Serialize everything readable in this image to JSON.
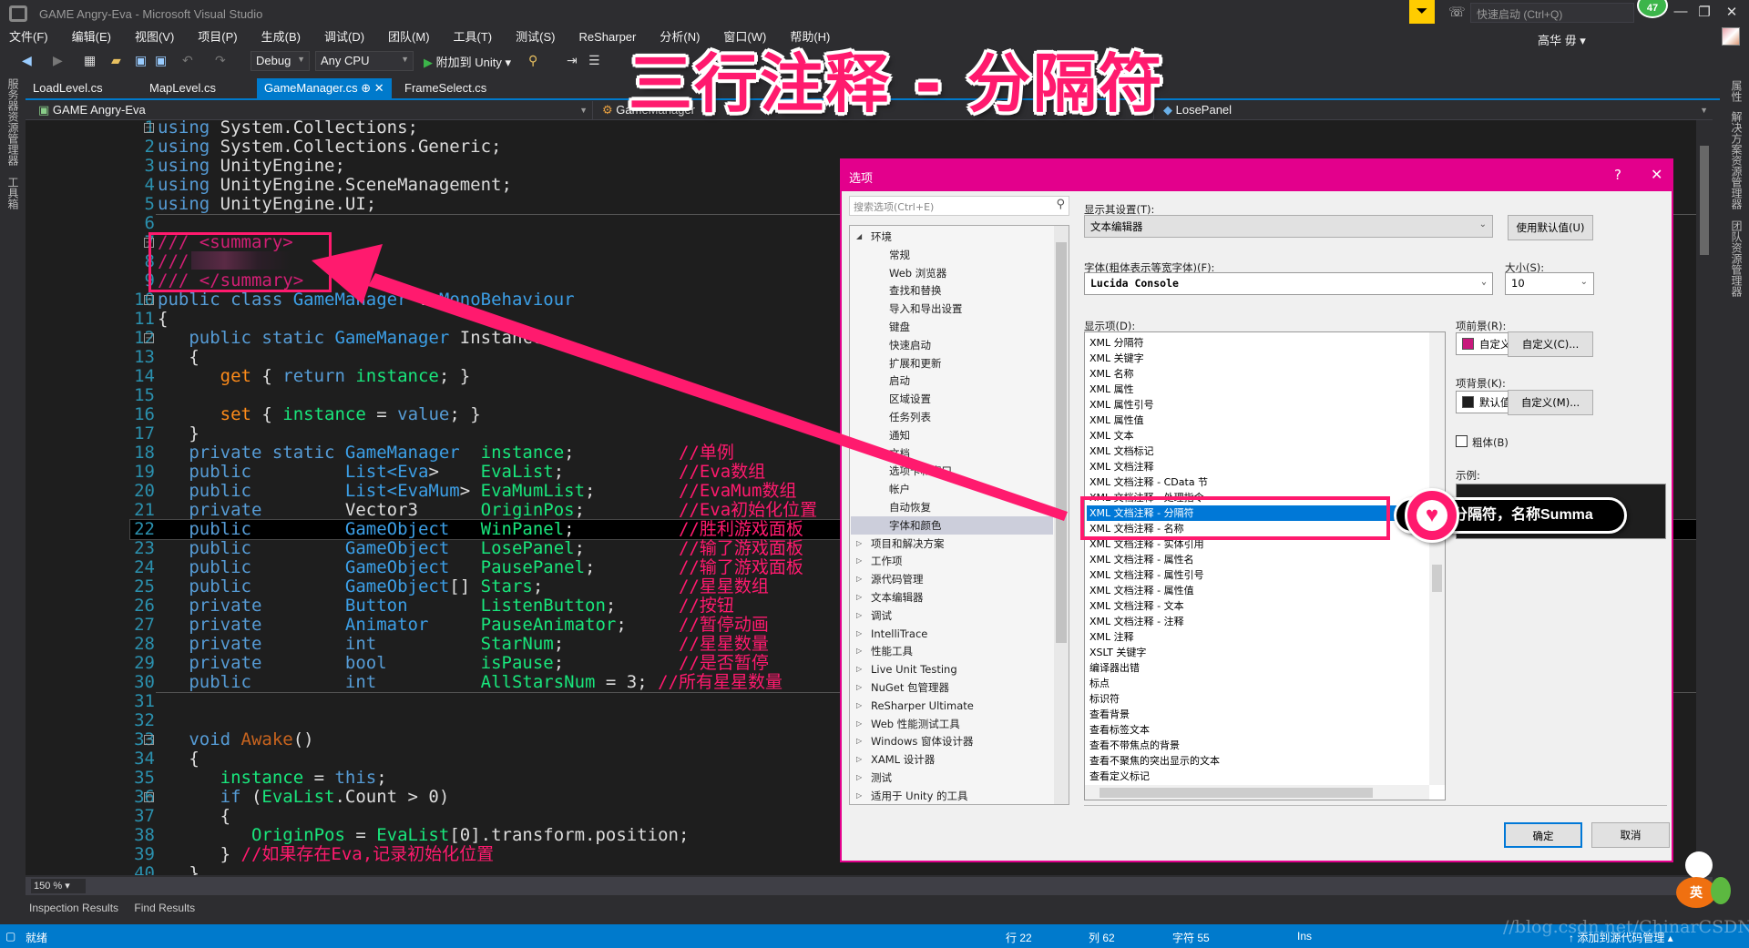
{
  "window": {
    "title": "GAME  Angry-Eva - Microsoft Visual Studio",
    "quick_launch_placeholder": "快速启动 (Ctrl+Q)",
    "notification_count": "47",
    "user_name": "高华 毋 ▾",
    "minimize": "—",
    "restore": "❐",
    "close": "✕"
  },
  "menu": [
    "文件(F)",
    "编辑(E)",
    "视图(V)",
    "项目(P)",
    "生成(B)",
    "调试(D)",
    "团队(M)",
    "工具(T)",
    "测试(S)",
    "ReSharper",
    "分析(N)",
    "窗口(W)",
    "帮助(H)"
  ],
  "toolbar": {
    "config": "Debug",
    "platform": "Any CPU",
    "attach": "附加到 Unity ▾"
  },
  "overlay_title": "三行注释 - 分隔符",
  "side_panels": {
    "left": [
      "服务器资源管理器",
      "工具箱"
    ],
    "right": [
      "属性",
      "解决方案资源管理器",
      "团队资源管理器"
    ]
  },
  "tabs": [
    {
      "label": "LoadLevel.cs"
    },
    {
      "label": "MapLevel.cs"
    },
    {
      "label": "GameManager.cs  ⊕  ✕",
      "active": true
    },
    {
      "label": "FrameSelect.cs"
    }
  ],
  "navbar": {
    "project": "GAME  Angry-Eva",
    "class": "GameManager",
    "member": "LosePanel"
  },
  "code": {
    "current_line": 22,
    "fold_lines": [
      1,
      7,
      10,
      12,
      33,
      36
    ],
    "separator_after": [
      5,
      30
    ],
    "lines": [
      [
        [
          "using",
          "kw"
        ],
        [
          " System.Collections;",
          "tx"
        ]
      ],
      [
        [
          "using",
          "kw"
        ],
        [
          " System.Collections.Generic;",
          "tx"
        ]
      ],
      [
        [
          "using",
          "kw"
        ],
        [
          " UnityEngine;",
          "tx"
        ]
      ],
      [
        [
          "using",
          "kw"
        ],
        [
          " UnityEngine.SceneManagement;",
          "tx"
        ]
      ],
      [
        [
          "using",
          "kw"
        ],
        [
          " UnityEngine.UI;",
          "tx"
        ]
      ],
      [],
      [
        [
          "/// <summary>",
          "doc"
        ]
      ],
      [
        [
          "///",
          "doc"
        ]
      ],
      [
        [
          "/// </summary>",
          "doc"
        ]
      ],
      [
        [
          "public class ",
          "kw"
        ],
        [
          "GameManager",
          "ty"
        ],
        [
          " : ",
          "tx"
        ],
        [
          "MonoBehaviour",
          "ty"
        ]
      ],
      [
        [
          "{",
          "tx"
        ]
      ],
      [
        [
          "   public static ",
          "kw"
        ],
        [
          "GameManager",
          "ty"
        ],
        [
          " Instance",
          "tx"
        ]
      ],
      [
        [
          "   {",
          "tx"
        ]
      ],
      [
        [
          "      get",
          "ac"
        ],
        [
          " { ",
          "tx"
        ],
        [
          "return",
          "kw"
        ],
        [
          " instance",
          "id"
        ],
        [
          "; }",
          "tx"
        ]
      ],
      [],
      [
        [
          "      set",
          "ac"
        ],
        [
          " { ",
          "tx"
        ],
        [
          "instance",
          "id"
        ],
        [
          " = ",
          "tx"
        ],
        [
          "value",
          "kw"
        ],
        [
          "; }",
          "tx"
        ]
      ],
      [
        [
          "   }",
          "tx"
        ]
      ],
      [
        [
          "   private static ",
          "kw"
        ],
        [
          "GameManager  ",
          "ty"
        ],
        [
          "instance",
          "id"
        ],
        [
          ";          ",
          "tx"
        ],
        [
          "//单例",
          "cm"
        ]
      ],
      [
        [
          "   public         ",
          "kw"
        ],
        [
          "List<",
          "ty"
        ],
        [
          "Eva",
          "ty"
        ],
        [
          ">    ",
          "tx"
        ],
        [
          "EvaList",
          "id"
        ],
        [
          ";           ",
          "tx"
        ],
        [
          "//Eva数组",
          "cm"
        ]
      ],
      [
        [
          "   public         ",
          "kw"
        ],
        [
          "List<",
          "ty"
        ],
        [
          "EvaMum",
          "ty"
        ],
        [
          "> ",
          "tx"
        ],
        [
          "EvaMumList",
          "id"
        ],
        [
          ";        ",
          "tx"
        ],
        [
          "//EvaMum数组",
          "cm"
        ]
      ],
      [
        [
          "   private        ",
          "kw"
        ],
        [
          "Vector3      ",
          "tx"
        ],
        [
          "OriginPos",
          "id"
        ],
        [
          ";         ",
          "tx"
        ],
        [
          "//Eva初始化位置",
          "cm"
        ]
      ],
      [
        [
          "   public         ",
          "kw"
        ],
        [
          "GameObject   ",
          "ty"
        ],
        [
          "WinPanel",
          "id"
        ],
        [
          ";          ",
          "tx"
        ],
        [
          "//胜利游戏面板",
          "cm"
        ]
      ],
      [
        [
          "   public         ",
          "kw"
        ],
        [
          "GameObject   ",
          "ty"
        ],
        [
          "LosePanel",
          "id"
        ],
        [
          ";         ",
          "tx"
        ],
        [
          "//输了游戏面板",
          "cm"
        ]
      ],
      [
        [
          "   public         ",
          "kw"
        ],
        [
          "GameObject   ",
          "ty"
        ],
        [
          "PausePanel",
          "id"
        ],
        [
          ";        ",
          "tx"
        ],
        [
          "//输了游戏面板",
          "cm"
        ]
      ],
      [
        [
          "   public         ",
          "kw"
        ],
        [
          "GameObject",
          "ty"
        ],
        [
          "[] ",
          "tx"
        ],
        [
          "Stars",
          "id"
        ],
        [
          ";             ",
          "tx"
        ],
        [
          "//星星数组",
          "cm"
        ]
      ],
      [
        [
          "   private        ",
          "kw"
        ],
        [
          "Button       ",
          "ty"
        ],
        [
          "ListenButton",
          "id"
        ],
        [
          ";      ",
          "tx"
        ],
        [
          "//按钮",
          "cm"
        ]
      ],
      [
        [
          "   private        ",
          "kw"
        ],
        [
          "Animator     ",
          "ty"
        ],
        [
          "PauseAnimator",
          "id"
        ],
        [
          ";     ",
          "tx"
        ],
        [
          "//暂停动画",
          "cm"
        ]
      ],
      [
        [
          "   private        ",
          "kw"
        ],
        [
          "int          ",
          "kw"
        ],
        [
          "StarNum",
          "id"
        ],
        [
          ";           ",
          "tx"
        ],
        [
          "//星星数量",
          "cm"
        ]
      ],
      [
        [
          "   private        ",
          "kw"
        ],
        [
          "bool         ",
          "kw"
        ],
        [
          "isPause",
          "id"
        ],
        [
          ";           ",
          "tx"
        ],
        [
          "//是否暂停",
          "cm"
        ]
      ],
      [
        [
          "   public         ",
          "kw"
        ],
        [
          "int          ",
          "kw"
        ],
        [
          "AllStarsNum",
          "id"
        ],
        [
          " = 3; ",
          "tx"
        ],
        [
          "//所有星星数量",
          "cm"
        ]
      ],
      [],
      [],
      [
        [
          "   void ",
          "kw"
        ],
        [
          "Awake",
          "mt"
        ],
        [
          "()",
          "tx"
        ]
      ],
      [
        [
          "   {",
          "tx"
        ]
      ],
      [
        [
          "      instance",
          "id"
        ],
        [
          " = ",
          "tx"
        ],
        [
          "this",
          "kw"
        ],
        [
          ";",
          "tx"
        ]
      ],
      [
        [
          "      if",
          "kw"
        ],
        [
          " (",
          "tx"
        ],
        [
          "EvaList",
          "id"
        ],
        [
          ".Count > 0)",
          "tx"
        ]
      ],
      [
        [
          "      {",
          "tx"
        ]
      ],
      [
        [
          "         OriginPos",
          "id"
        ],
        [
          " = ",
          "tx"
        ],
        [
          "EvaList",
          "id"
        ],
        [
          "[0].transform.position;",
          "tx"
        ]
      ],
      [
        [
          "      } ",
          "tx"
        ],
        [
          "//如果存在Eva,记录初始化位置",
          "cm"
        ]
      ],
      [
        [
          "   }",
          "tx"
        ]
      ]
    ]
  },
  "editor_zoom": "150 %",
  "bottom_tabs": [
    "Inspection Results",
    "Find Results"
  ],
  "status": {
    "ready": "就绪",
    "line": "行 22",
    "col": "列 62",
    "char": "字符 55",
    "mode": "Ins",
    "source_control": "↑ 添加到源代码管理 ▴"
  },
  "watermark": "//blog.csdn.net/ChinarCSDN",
  "ime_label": "英",
  "dialog": {
    "title": "选项",
    "help": "?",
    "close": "✕",
    "search_placeholder": "搜索选项(Ctrl+E)",
    "tree": [
      {
        "label": "环境",
        "level": 0,
        "expanded": true
      },
      {
        "label": "常规",
        "level": 1
      },
      {
        "label": "Web 浏览器",
        "level": 1
      },
      {
        "label": "查找和替换",
        "level": 1
      },
      {
        "label": "导入和导出设置",
        "level": 1
      },
      {
        "label": "键盘",
        "level": 1
      },
      {
        "label": "快速启动",
        "level": 1
      },
      {
        "label": "扩展和更新",
        "level": 1
      },
      {
        "label": "启动",
        "level": 1
      },
      {
        "label": "区域设置",
        "level": 1
      },
      {
        "label": "任务列表",
        "level": 1
      },
      {
        "label": "通知",
        "level": 1
      },
      {
        "label": "文档",
        "level": 1
      },
      {
        "label": "选项卡和窗口",
        "level": 1
      },
      {
        "label": "帐户",
        "level": 1
      },
      {
        "label": "自动恢复",
        "level": 1
      },
      {
        "label": "字体和颜色",
        "level": 1,
        "selected": true
      },
      {
        "label": "项目和解决方案",
        "level": 0
      },
      {
        "label": "工作项",
        "level": 0
      },
      {
        "label": "源代码管理",
        "level": 0
      },
      {
        "label": "文本编辑器",
        "level": 0
      },
      {
        "label": "调试",
        "level": 0
      },
      {
        "label": "IntelliTrace",
        "level": 0
      },
      {
        "label": "性能工具",
        "level": 0
      },
      {
        "label": "Live Unit Testing",
        "level": 0
      },
      {
        "label": "NuGet 包管理器",
        "level": 0
      },
      {
        "label": "ReSharper Ultimate",
        "level": 0
      },
      {
        "label": "Web 性能测试工具",
        "level": 0
      },
      {
        "label": "Windows 窗体设计器",
        "level": 0
      },
      {
        "label": "XAML 设计器",
        "level": 0
      },
      {
        "label": "测试",
        "level": 0
      },
      {
        "label": "适用于 Unity 的工具",
        "level": 0
      }
    ],
    "show_settings_label": "显示其设置(T):",
    "show_settings_value": "文本编辑器",
    "use_defaults": "使用默认值(U)",
    "font_label": "字体(粗体表示等宽字体)(F):",
    "font_value": "Lucida Console",
    "size_label": "大小(S):",
    "size_value": "10",
    "display_items_label": "显示项(D):",
    "display_items": [
      "XML 分隔符",
      "XML 关键字",
      "XML 名称",
      "XML 属性",
      "XML 属性引号",
      "XML 属性值",
      "XML 文本",
      "XML 文档标记",
      "XML 文档注释",
      "XML 文档注释 - CData 节",
      "XML 文档注释 - 处理指令",
      "XML 文档注释 - 分隔符",
      "XML 文档注释 - 名称",
      "XML 文档注释 - 实体引用",
      "XML 文档注释 - 属性名",
      "XML 文档注释 - 属性引号",
      "XML 文档注释 - 属性值",
      "XML 文档注释 - 文本",
      "XML 文档注释 - 注释",
      "XML 注释",
      "XSLT 关键字",
      "编译器出错",
      "标点",
      "标识符",
      "查看背景",
      "查看标签文本",
      "查看不带焦点的背景",
      "查看不聚焦的突出显示的文本",
      "查看定义标记"
    ],
    "selected_item": "XML 文档注释 - 分隔符",
    "foreground_label": "项前景(R):",
    "foreground_value": "自定义",
    "foreground_color": "#c8187c",
    "foreground_custom": "自定义(C)...",
    "background_label": "项背景(K):",
    "background_value": "默认值",
    "background_color": "#1e1e1e",
    "background_custom": "自定义(M)...",
    "bold_label": "粗体(B)",
    "bold_checked": false,
    "sample_label": "示例:",
    "ok": "确定",
    "cancel": "取消"
  },
  "annotation": {
    "callout": "分隔符，名称Summa",
    "color": "#ff1a6e"
  }
}
